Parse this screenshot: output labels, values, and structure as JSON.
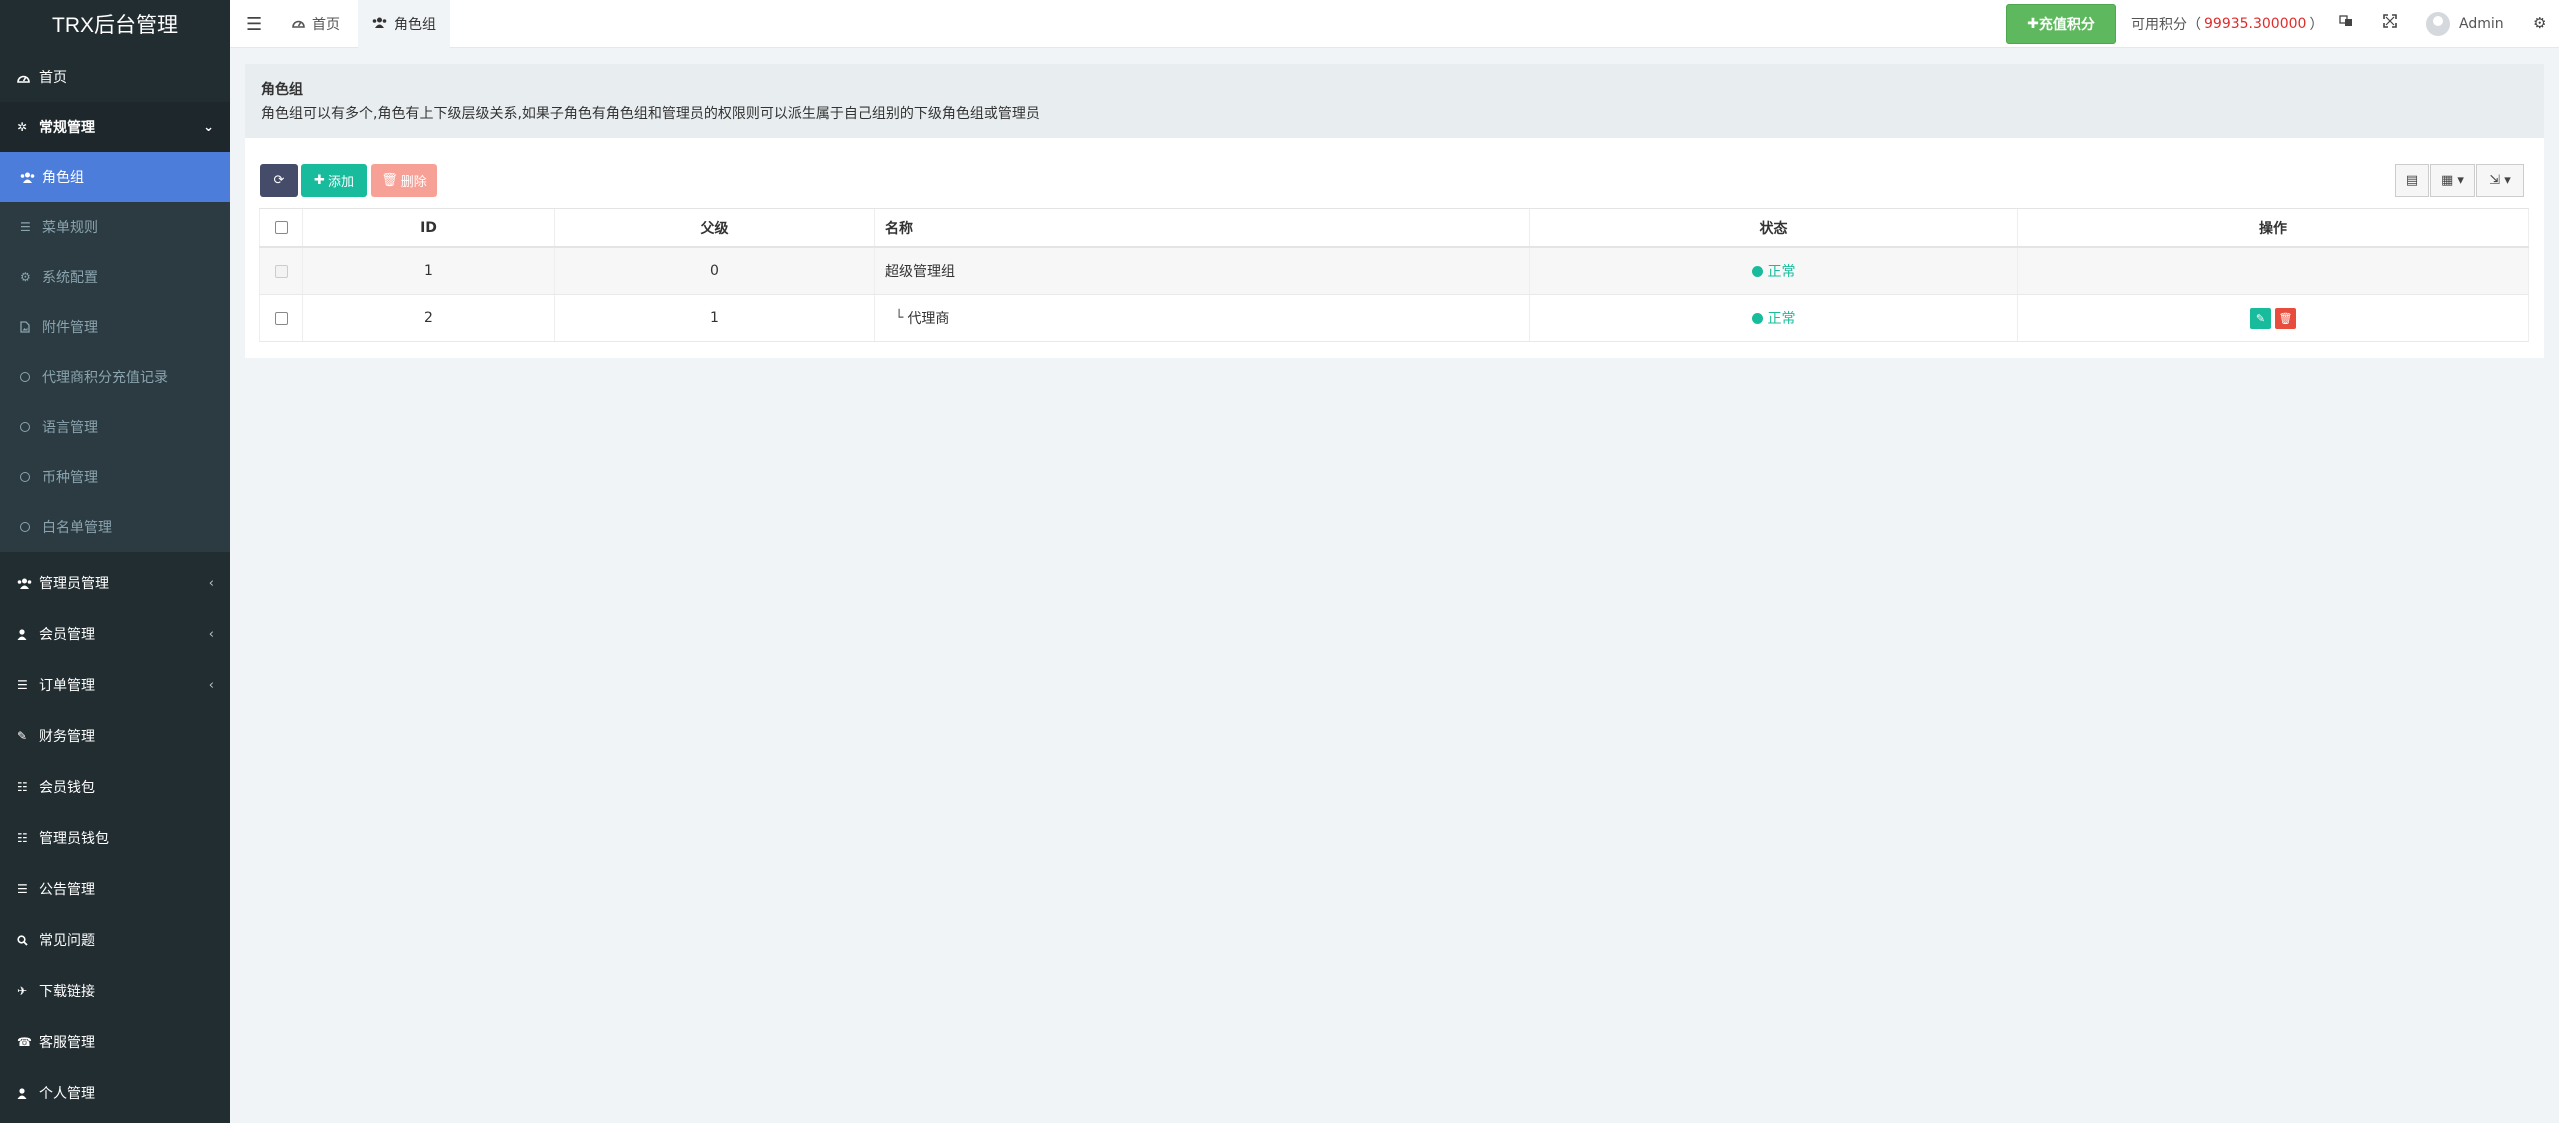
{
  "app": {
    "title": "TRX后台管理"
  },
  "sidebar": {
    "items": [
      {
        "label": "首页",
        "icon": "dashboard-icon"
      },
      {
        "label": "常规管理",
        "icon": "cogs-icon"
      },
      {
        "label": "角色组",
        "icon": "group-icon"
      },
      {
        "label": "菜单规则",
        "icon": "bars-icon"
      },
      {
        "label": "系统配置",
        "icon": "cog-icon"
      },
      {
        "label": "附件管理",
        "icon": "file-image-icon"
      },
      {
        "label": "代理商积分充值记录",
        "icon": "circle-o-icon"
      },
      {
        "label": "语言管理",
        "icon": "circle-o-icon"
      },
      {
        "label": "币种管理",
        "icon": "circle-o-icon"
      },
      {
        "label": "白名单管理",
        "icon": "circle-o-icon"
      },
      {
        "label": "管理员管理",
        "icon": "users-icon"
      },
      {
        "label": "会员管理",
        "icon": "user-icon"
      },
      {
        "label": "订单管理",
        "icon": "list-icon"
      },
      {
        "label": "财务管理",
        "icon": "edit-icon"
      },
      {
        "label": "会员钱包",
        "icon": "list-alt-icon"
      },
      {
        "label": "管理员钱包",
        "icon": "list-alt-icon"
      },
      {
        "label": "公告管理",
        "icon": "list-icon"
      },
      {
        "label": "常见问题",
        "icon": "search-icon"
      },
      {
        "label": "下载链接",
        "icon": "plane-icon"
      },
      {
        "label": "客服管理",
        "icon": "phone-square-icon"
      },
      {
        "label": "个人管理",
        "icon": "user-icon"
      }
    ]
  },
  "header": {
    "tabs": [
      {
        "label": "首页",
        "icon": "dashboard-icon"
      },
      {
        "label": "角色组",
        "icon": "group-icon"
      }
    ],
    "recharge_label": "充值积分",
    "points_label": "可用积分（",
    "points_value": "99935.300000",
    "points_suffix": "）",
    "user_name": "Admin"
  },
  "panel": {
    "title": "角色组",
    "description": "角色组可以有多个,角色有上下级层级关系,如果子角色有角色组和管理员的权限则可以派生属于自己组别的下级角色组或管理员"
  },
  "toolbar": {
    "add_label": "添加",
    "delete_label": "删除"
  },
  "table": {
    "columns": [
      "ID",
      "父级",
      "名称",
      "状态",
      "操作"
    ],
    "rows": [
      {
        "id": "1",
        "parent": "0",
        "tree": "",
        "name": "超级管理组",
        "status": "正常"
      },
      {
        "id": "2",
        "parent": "1",
        "tree": "└",
        "name": "代理商",
        "status": "正常"
      }
    ]
  },
  "colors": {
    "sidebar_bg": "#222d32",
    "active_item": "#4d7ddb",
    "success": "#18bc9c",
    "danger": "#e74c3c",
    "recharge": "#5eb95e",
    "points_value": "#e02b2b"
  }
}
